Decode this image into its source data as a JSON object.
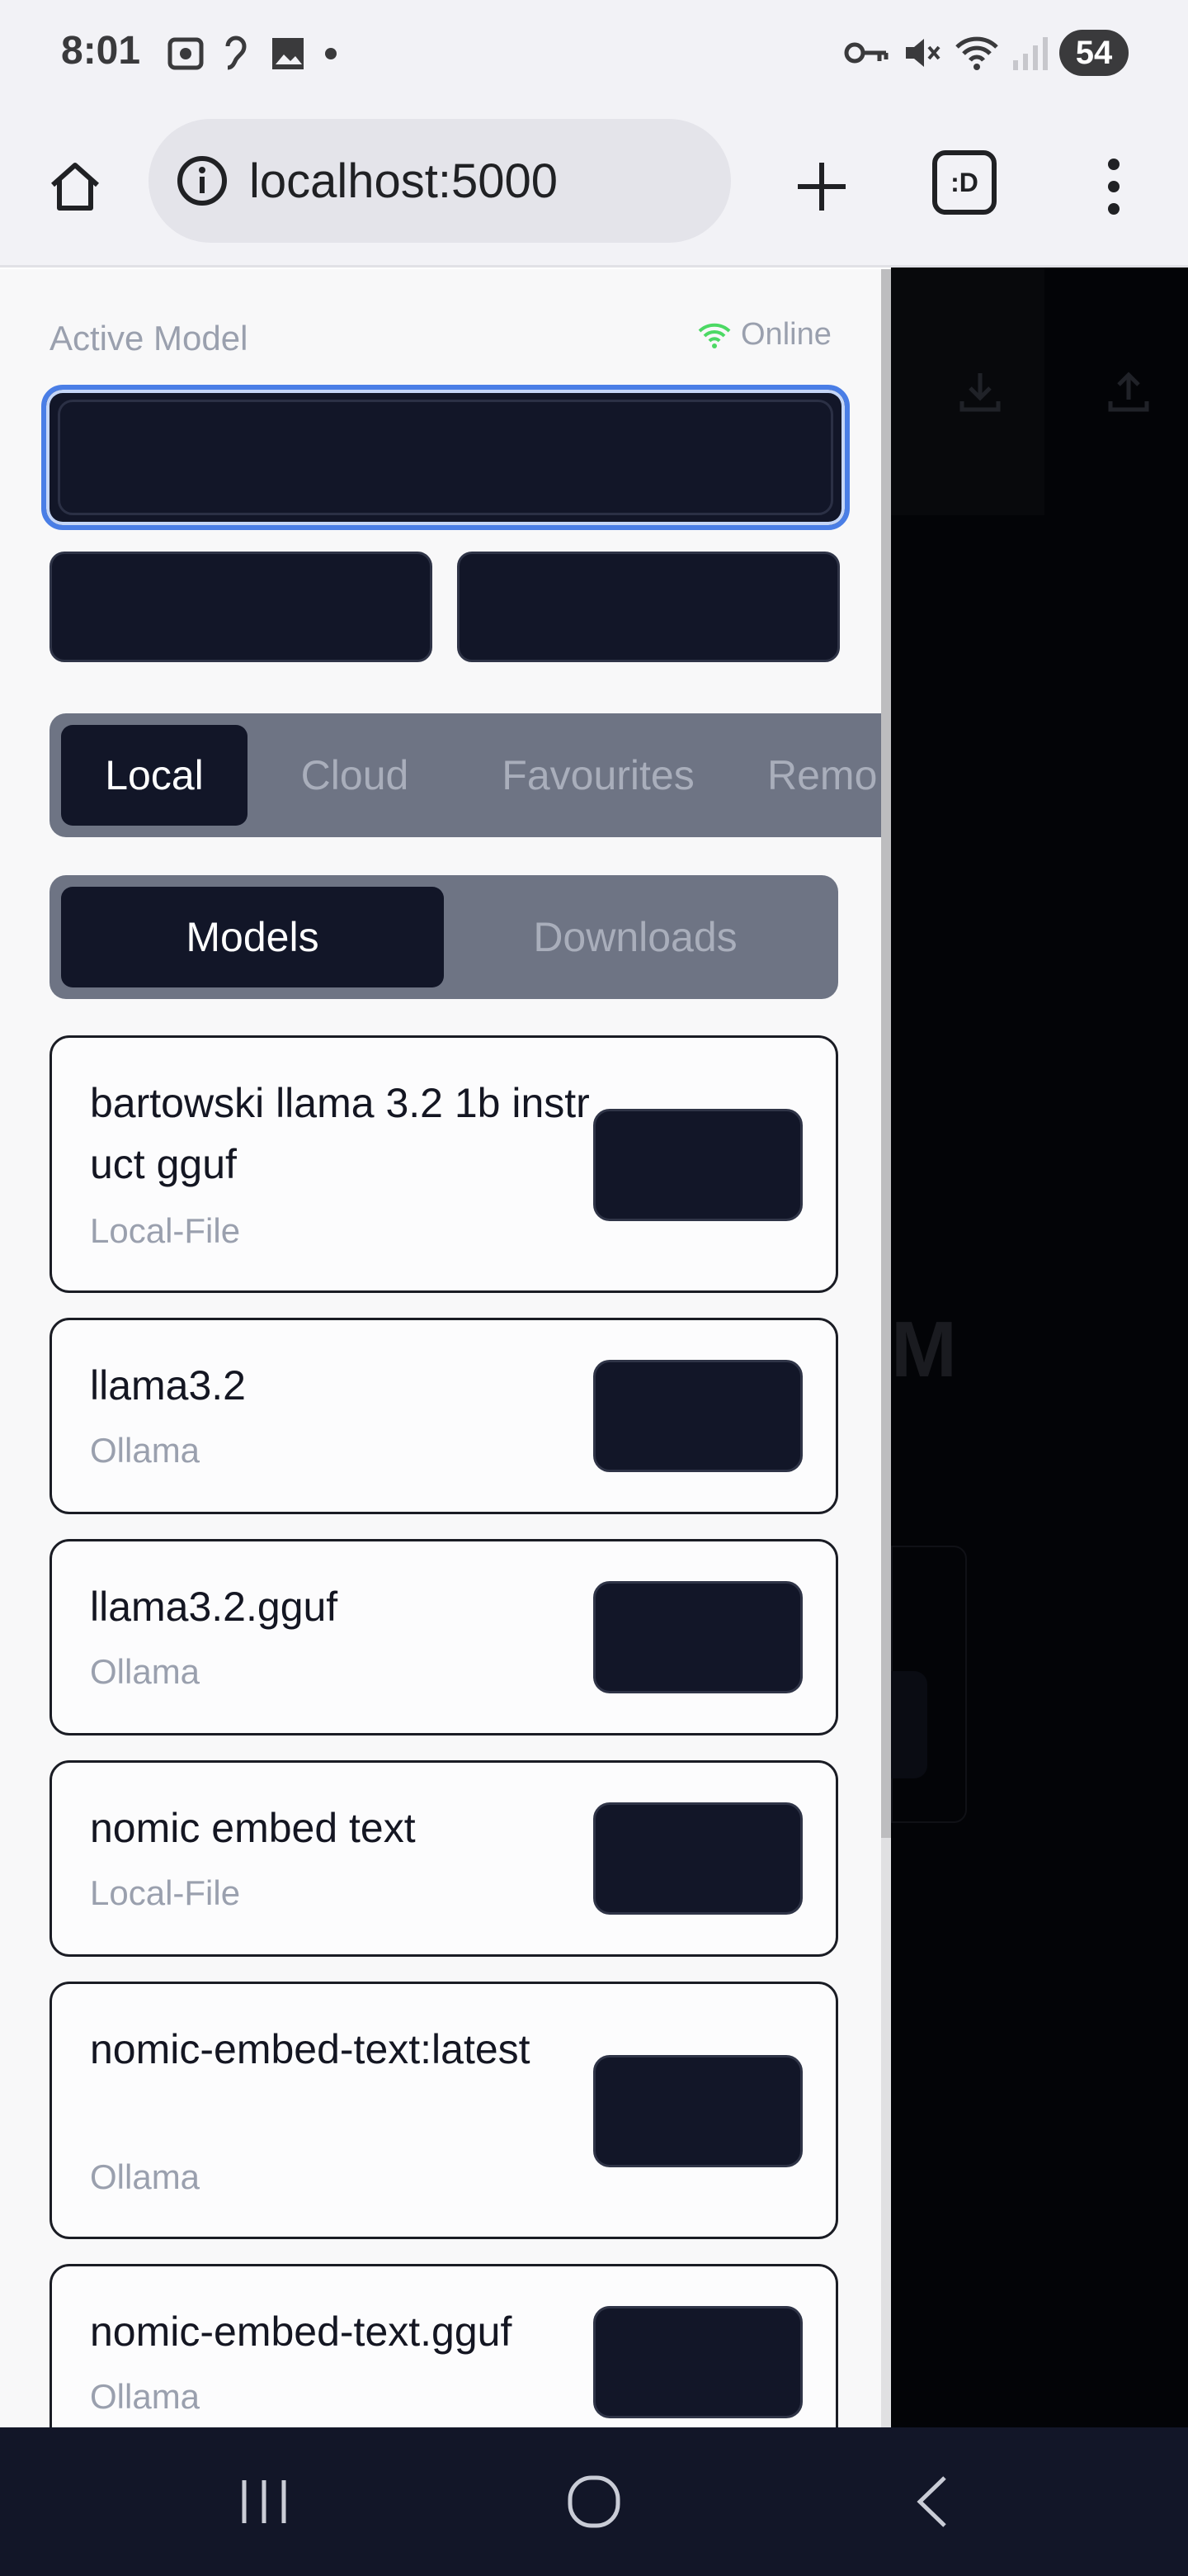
{
  "status_bar": {
    "time": "8:01",
    "battery": "54"
  },
  "browser": {
    "url": "localhost:5000",
    "tabs_icon_label": ":D"
  },
  "drawer": {
    "active_model_label": "Active Model",
    "status_text": "Online",
    "tabs": [
      {
        "label": "Local",
        "active": true
      },
      {
        "label": "Cloud",
        "active": false
      },
      {
        "label": "Favourites",
        "active": false
      },
      {
        "label": "Remo",
        "active": false
      }
    ],
    "subtabs": [
      {
        "label": "Models",
        "active": true
      },
      {
        "label": "Downloads",
        "active": false
      }
    ],
    "models": [
      {
        "name": "bartowski llama 3.2 1b instruct gguf",
        "source": "Local-File"
      },
      {
        "name": "llama3.2",
        "source": "Ollama"
      },
      {
        "name": "llama3.2.gguf",
        "source": "Ollama"
      },
      {
        "name": "nomic embed text",
        "source": "Local-File"
      },
      {
        "name": "nomic-embed-text:latest",
        "source": "Ollama"
      },
      {
        "name": "nomic-embed-text.gguf",
        "source": "Ollama"
      }
    ]
  },
  "background_app": {
    "partial_heading": "M"
  },
  "colors": {
    "accent": "#4a7ee6",
    "dark": "#121628",
    "online": "#4cd964"
  },
  "icons": {
    "home": "home-icon",
    "info": "info-icon",
    "plus": "plus-icon",
    "menu": "more-vert-icon",
    "wifi": "wifi-icon",
    "download": "download-icon",
    "upload": "upload-icon"
  }
}
